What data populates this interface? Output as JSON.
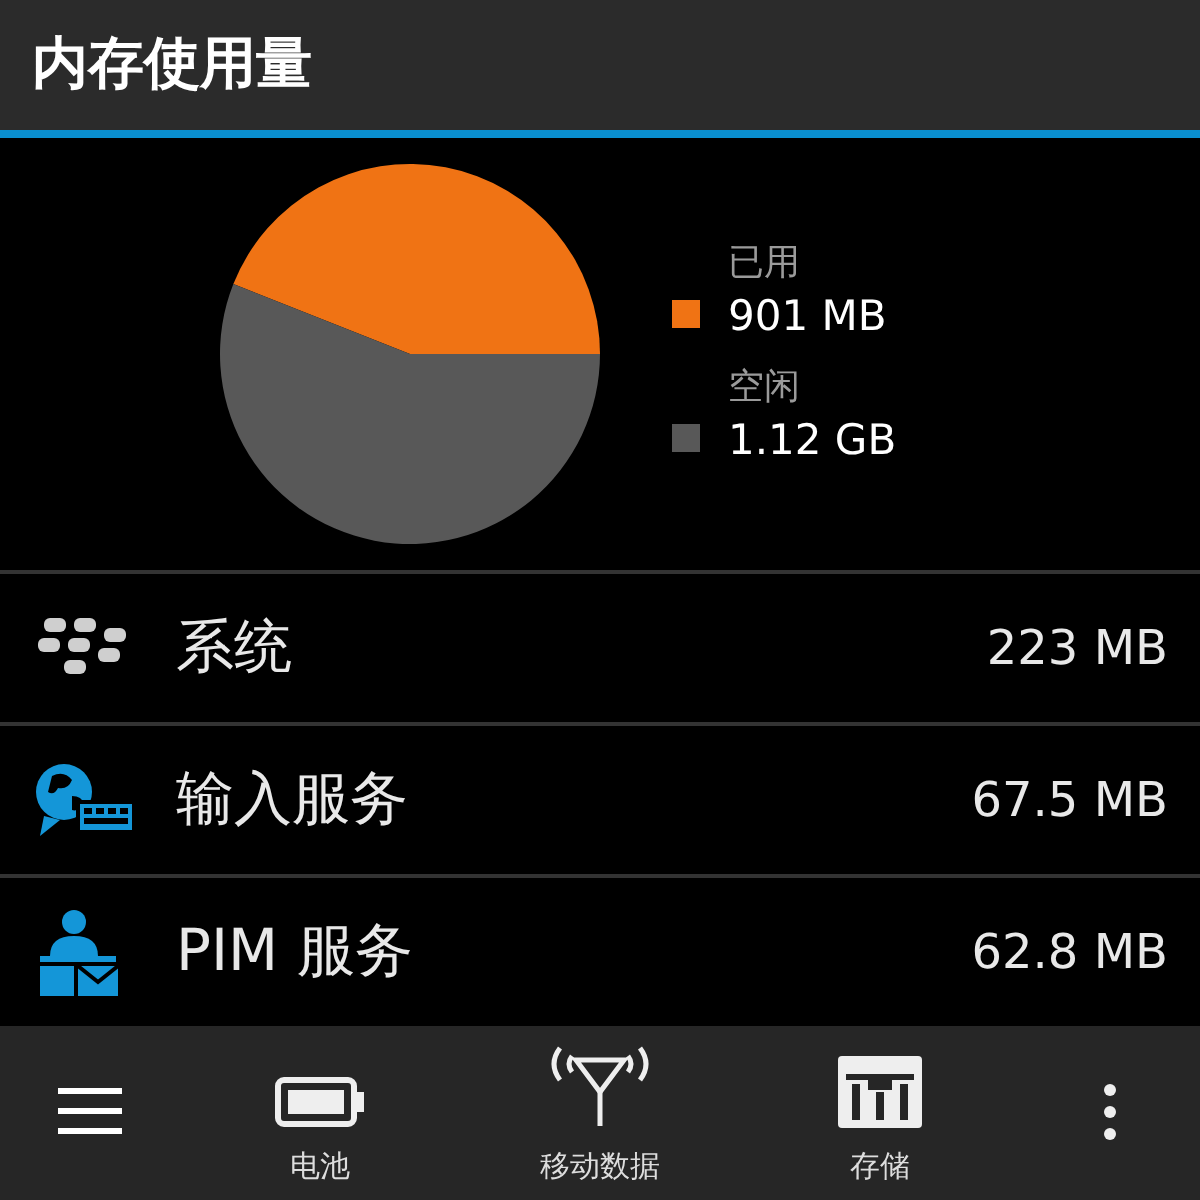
{
  "title": "内存使用量",
  "legend": [
    {
      "value": "901 MB",
      "color": "#f07314"
    },
    {
      "value": "1.12 GB",
      "color": "#585858"
    }
  ],
  "chart_data": {
    "type": "pie",
    "categories": [
      "已用",
      "空闲"
    ],
    "values": [
      44,
      56
    ]
  },
  "apps": [
    {
      "kind": "system",
      "name": "系统",
      "size": "223 MB"
    },
    {
      "kind": "input",
      "name": "输入服务",
      "size": "67.5 MB"
    },
    {
      "kind": "pim",
      "name": "PIM 服务",
      "size": "62.8 MB"
    }
  ],
  "bottom_bar": [
    {
      "kind": "menu"
    },
    {
      "kind": "battery",
      "label": "电池"
    },
    {
      "kind": "antenna",
      "label": "移动数据"
    },
    {
      "kind": "storage",
      "label": "存储"
    },
    {
      "kind": "more"
    }
  ]
}
